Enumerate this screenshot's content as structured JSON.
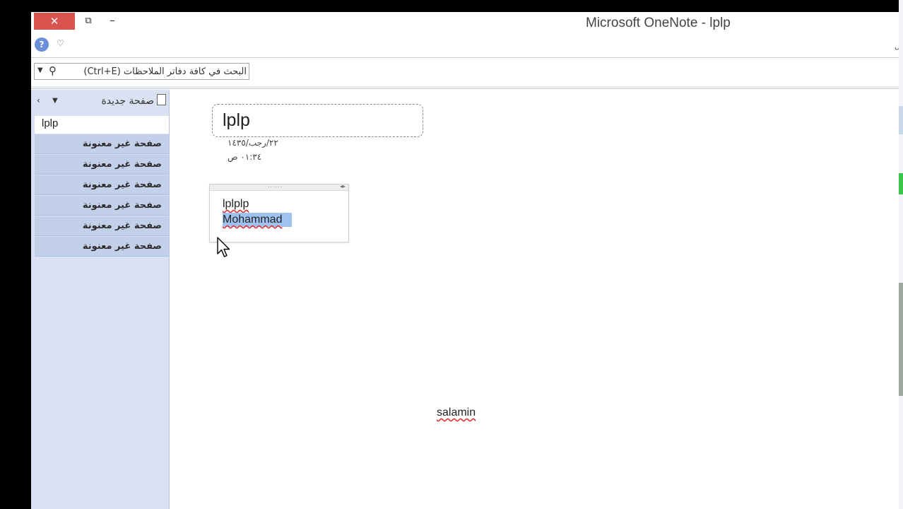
{
  "window": {
    "title": "Microsoft OneNote - lplp",
    "close_label": "✕",
    "restore_label": "⧉",
    "minimize_label": "–"
  },
  "quickbar": {
    "help_glyph": "?",
    "toggle_glyph": "♡",
    "corner_glyph": "ل"
  },
  "search": {
    "placeholder": "البحث في كافة دفاتر الملاحظات (Ctrl+E)",
    "icon": "search-icon"
  },
  "sidebar": {
    "chevron_glyph": "‹",
    "menu_glyph": "▼",
    "new_page_label": "صفحة جديدة",
    "current_page": "lplp",
    "pages": [
      {
        "label": "صفحة غير معنونة"
      },
      {
        "label": "صفحة غير معنونة"
      },
      {
        "label": "صفحة غير معنونة"
      },
      {
        "label": "صفحة غير معنونة"
      },
      {
        "label": "صفحة غير معنونة"
      },
      {
        "label": "صفحة غير معنونة"
      }
    ]
  },
  "page": {
    "title": "lplp",
    "date": "٢٢/رجب/١٤٣٥",
    "time": "٠١:٣٤ ص",
    "note": {
      "line1": "lplplp",
      "line2": "Mohammad"
    },
    "floating_note": "salamin"
  },
  "colors": {
    "close_button": "#d9534f",
    "sidebar_bg": "#d9e1f2",
    "page_item_bg": "#c3d0ea",
    "selection": "#9fc3f0"
  }
}
